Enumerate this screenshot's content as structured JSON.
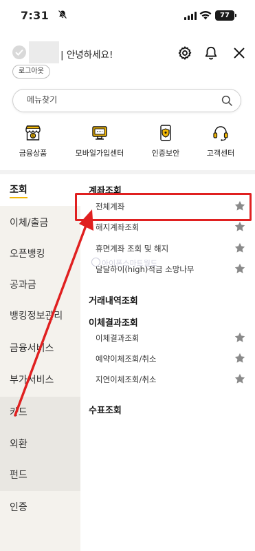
{
  "status": {
    "time": "7:31",
    "battery": "77"
  },
  "header": {
    "greeting": "| 안녕하세요!",
    "logout_label": "로그아웃"
  },
  "search": {
    "placeholder": "메뉴찾기"
  },
  "quick_menu": [
    {
      "label": "금융상품",
      "icon": "bank-store-icon"
    },
    {
      "label": "모바일가입센터",
      "icon": "monitor-icon"
    },
    {
      "label": "인증보안",
      "icon": "shield-phone-icon"
    },
    {
      "label": "고객센터",
      "icon": "headset-icon"
    }
  ],
  "left_nav": [
    {
      "label": "조회"
    },
    {
      "label": "이체/출금"
    },
    {
      "label": "오픈뱅킹"
    },
    {
      "label": "공과금"
    },
    {
      "label": "뱅킹정보관리"
    },
    {
      "label": "금융서비스"
    },
    {
      "label": "부가서비스"
    },
    {
      "label": "카드"
    },
    {
      "label": "외환"
    },
    {
      "label": "펀드"
    },
    {
      "label": "인증"
    }
  ],
  "sections": [
    {
      "title": "계좌조회",
      "items": [
        "전체계좌",
        "해지계좌조회",
        "휴면계좌 조회 및 해지",
        "달달하이(high)적금 소망나무"
      ]
    },
    {
      "title": "거래내역조회",
      "items": []
    },
    {
      "title": "이체결과조회",
      "items": [
        "이체결과조회",
        "예약이체조회/취소",
        "지연이체조회/취소"
      ]
    },
    {
      "title": "수표조회",
      "items": []
    }
  ],
  "watermark": "아이폰스마트월드",
  "colors": {
    "accent": "#f2b705",
    "highlight": "#e02020",
    "star": "#8a8a8a",
    "nav_bg": "#f4f2ed"
  }
}
